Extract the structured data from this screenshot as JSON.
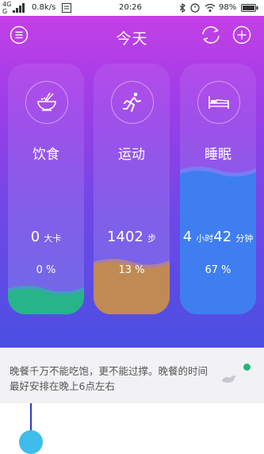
{
  "status_bar": {
    "network": "4G",
    "network2": "G",
    "speed": "0.8k/s",
    "time": "20:26",
    "battery": "98%"
  },
  "header": {
    "title": "今天",
    "menu_icon": "menu-icon",
    "sync_icon": "sync-icon",
    "add_icon": "add-icon"
  },
  "cards": [
    {
      "name": "饮食",
      "icon": "bowl-icon",
      "value": "0",
      "unit": "大卡",
      "percent": "0 %",
      "fill_fraction": 0.05,
      "color": "#27b48a"
    },
    {
      "name": "运动",
      "icon": "runner-icon",
      "value": "1402",
      "unit": "步",
      "percent": "13 %",
      "fill_fraction": 0.13,
      "color": "#c08a55"
    },
    {
      "name": "睡眠",
      "icon": "bed-icon",
      "value_hours": "4",
      "unit_hours": "小时",
      "value_minutes": "42",
      "unit_minutes": "分钟",
      "percent": "67 %",
      "fill_fraction": 0.67,
      "color": "#3f7ef0"
    }
  ],
  "tip": {
    "text": "晚餐千万不能吃饱，更不能过撑。晚餐的时间最好安排在晚上6点左右",
    "icon": "bird-icon"
  },
  "colors": {
    "gradient_top": "#c43fe6",
    "gradient_bottom": "#4b4fe3",
    "accent_green": "#27b47b"
  }
}
